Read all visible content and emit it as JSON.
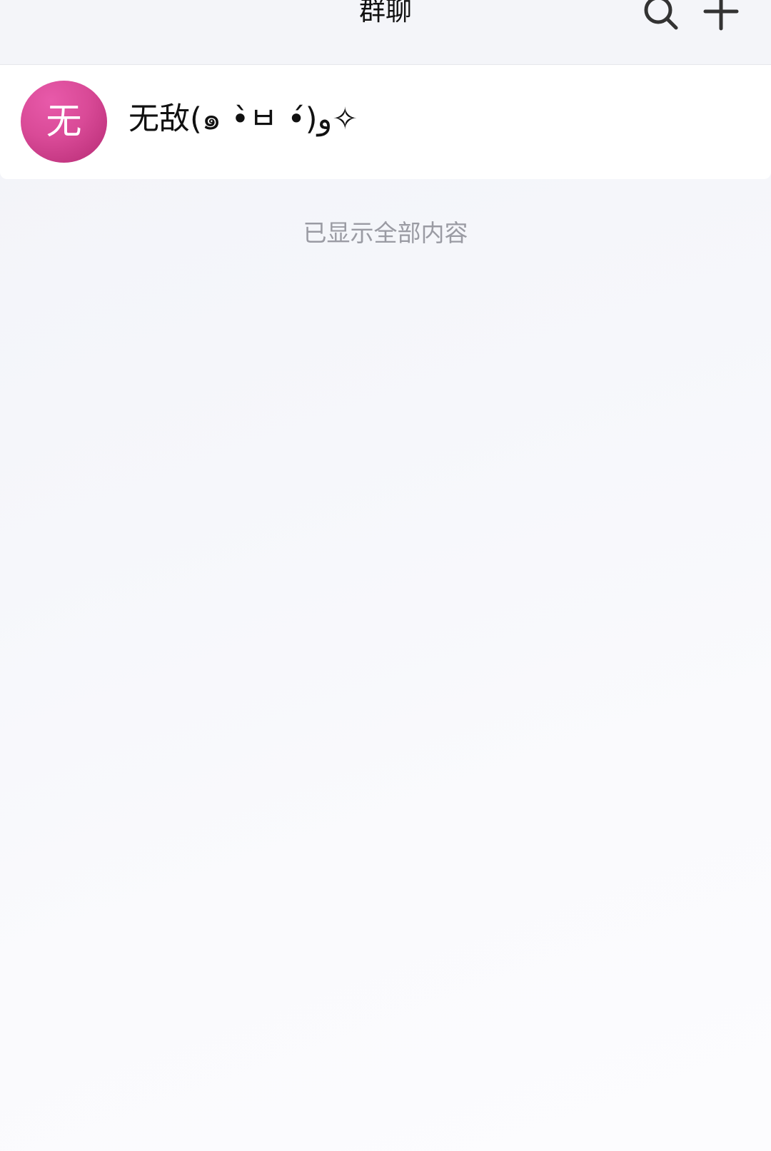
{
  "header": {
    "title": "群聊",
    "search_icon": "search-icon",
    "add_icon": "plus-icon"
  },
  "groups": [
    {
      "avatar_text": "无",
      "avatar_color": "#d94a97",
      "name": "无敌(๑ •̀ㅂ •́)و✧"
    }
  ],
  "footer": {
    "end_text": "已显示全部内容"
  }
}
